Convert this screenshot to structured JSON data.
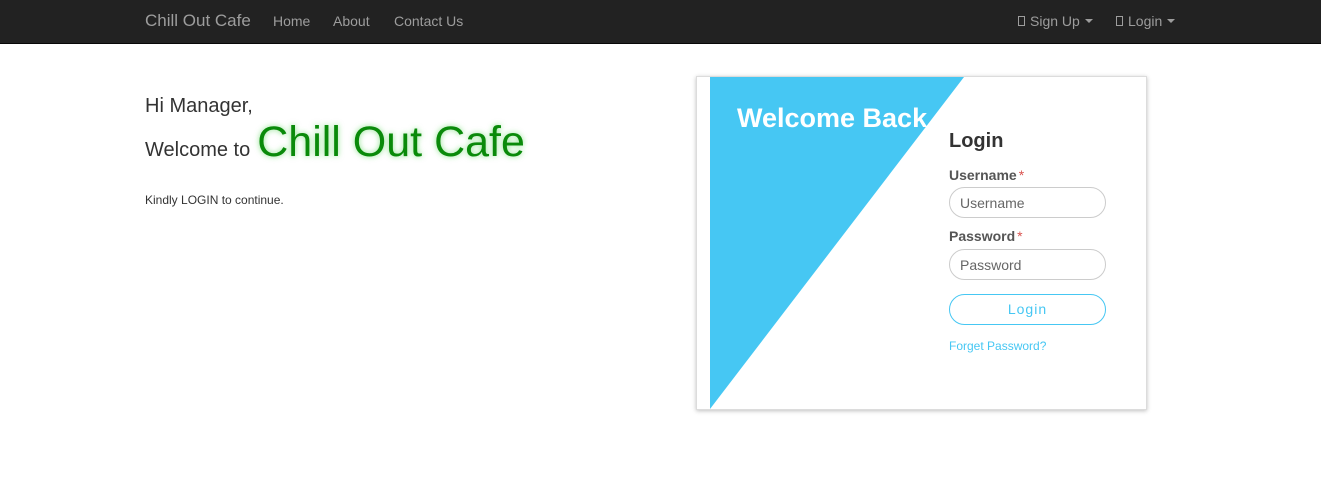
{
  "navbar": {
    "brand": "Chill Out Cafe",
    "links": [
      "Home",
      "About",
      "Contact Us"
    ],
    "signup_label": "Sign Up",
    "login_label": "Login",
    "background": "#222222",
    "text_color": "#9d9d9d"
  },
  "main": {
    "greeting": "Hi Manager,",
    "welcome_to": "Welcome to",
    "cafe_name": "Chill Out Cafe",
    "instruction": "Kindly LOGIN to continue.",
    "cafe_name_color": "#0a8a0a"
  },
  "login_card": {
    "banner_text": "Welcome Back",
    "banner_color": "#46c7f3",
    "heading": "Login",
    "username_label": "Username",
    "username_placeholder": "Username",
    "password_label": "Password",
    "password_placeholder": "Password",
    "required_marker": "*",
    "submit_label": "Login",
    "forgot_link": "Forget Password?"
  }
}
